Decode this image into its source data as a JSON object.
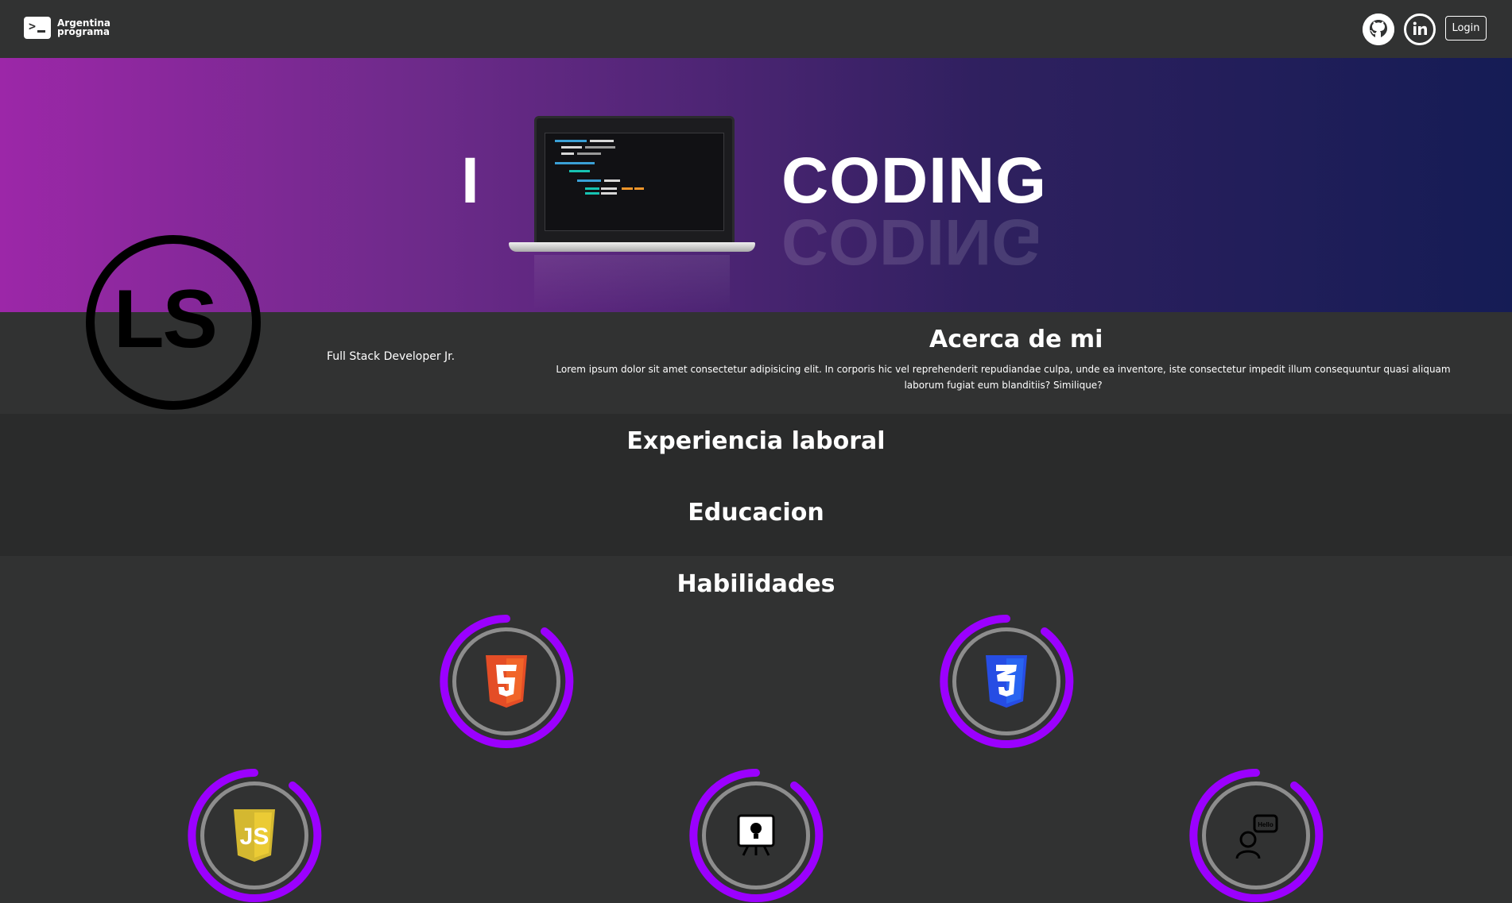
{
  "header": {
    "brand_line1": "Argentina",
    "brand_line2": "programa",
    "login_label": "Login",
    "icons": [
      "terminal-icon",
      "github-icon",
      "linkedin-icon"
    ]
  },
  "banner": {
    "text_i": "I",
    "text_coding": "CODING",
    "gradient_colors": [
      "#9c27a8",
      "#151c55"
    ]
  },
  "profile": {
    "logo_text": "LS",
    "role": "Full Stack Developer Jr.",
    "about_title": "Acerca de mi",
    "about_text": "Lorem ipsum dolor sit amet consectetur adipisicing elit. In corporis hic vel reprehenderit repudiandae culpa, unde ea inventore, iste consectetur impedit illum consequuntur quasi aliquam laborum fugiat eum blanditiis? Similique?"
  },
  "sections": {
    "experience_title": "Experiencia laboral",
    "education_title": "Educacion",
    "skills_title": "Habilidades"
  },
  "skills": [
    {
      "icon": "html5-icon",
      "badge": "5",
      "level": 0.85,
      "color": "#e44d26"
    },
    {
      "icon": "css3-icon",
      "badge": "3",
      "level": 0.85,
      "color": "#264de4"
    },
    {
      "icon": "javascript-icon",
      "badge": "JS",
      "level": 0.85,
      "color": "#d4b830"
    },
    {
      "icon": "lightbulb-presentation-icon",
      "badge": "",
      "level": 0.85,
      "color": "#ffffff"
    },
    {
      "icon": "communication-icon",
      "badge": "Hello",
      "level": 0.85,
      "color": "#313232"
    }
  ],
  "colors": {
    "background": "#313232",
    "skill_ring": "#9b00ff",
    "inner_ring": "#8d8d8d"
  }
}
